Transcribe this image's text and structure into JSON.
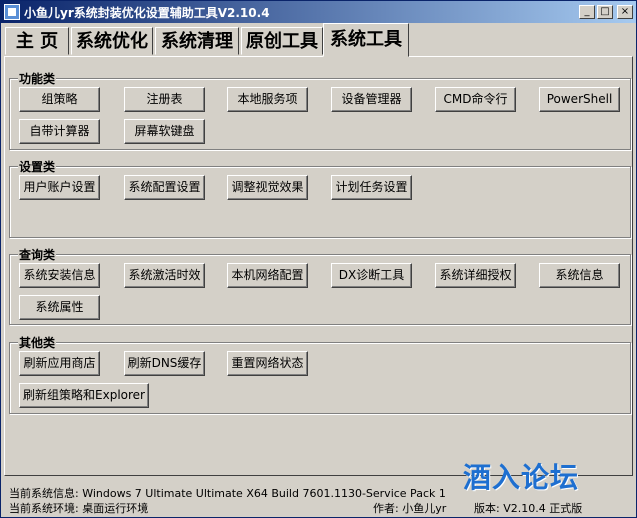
{
  "window": {
    "title": "小鱼儿yr系统封装优化设置辅助工具V2.10.4",
    "controls": {
      "minimize": "_",
      "maximize": "□",
      "close": "×"
    }
  },
  "tabs": [
    {
      "label": "主 页"
    },
    {
      "label": "系统优化"
    },
    {
      "label": "系统清理"
    },
    {
      "label": "原创工具"
    },
    {
      "label": "系统工具",
      "active": true
    }
  ],
  "groups": {
    "function": {
      "title": "功能类",
      "buttons": [
        "组策略",
        "注册表",
        "本地服务项",
        "设备管理器",
        "CMD命令行",
        "PowerShell",
        "自带计算器",
        "屏幕软键盘"
      ]
    },
    "settings": {
      "title": "设置类",
      "buttons": [
        "用户账户设置",
        "系统配置设置",
        "调整视觉效果",
        "计划任务设置"
      ]
    },
    "query": {
      "title": "查询类",
      "buttons": [
        "系统安装信息",
        "系统激活时效",
        "本机网络配置",
        "DX诊断工具",
        "系统详细授权",
        "系统信息",
        "系统属性"
      ]
    },
    "other": {
      "title": "其他类",
      "buttons": [
        "刷新应用商店",
        "刷新DNS缓存",
        "重置网络状态",
        "刷新组策略和Explorer"
      ]
    }
  },
  "status": {
    "system_info": "当前系统信息: Windows 7 Ultimate Ultimate X64 Build 7601.1130-Service Pack 1",
    "system_env": "当前系统环境: 桌面运行环境",
    "author": "作者: 小鱼儿yr",
    "version": "版本: V2.10.4 正式版"
  },
  "watermark": "酒入论坛"
}
